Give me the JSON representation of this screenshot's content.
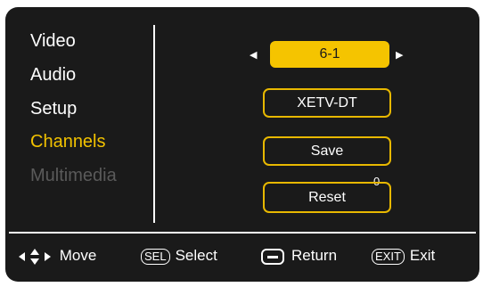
{
  "menu": {
    "items": [
      {
        "label": "Video",
        "state": "normal"
      },
      {
        "label": "Audio",
        "state": "normal"
      },
      {
        "label": "Setup",
        "state": "normal"
      },
      {
        "label": "Channels",
        "state": "active"
      },
      {
        "label": "Multimedia",
        "state": "disabled"
      }
    ]
  },
  "channels_panel": {
    "channel_number": "6-1",
    "station_name": "XETV-DT",
    "save_label": "Save",
    "reset_label": "Reset",
    "stray_digit": "0"
  },
  "footer": {
    "move_label": "Move",
    "select_key": "SEL",
    "select_label": "Select",
    "return_label": "Return",
    "exit_key": "EXIT",
    "exit_label": "Exit"
  },
  "colors": {
    "background": "#1a1a1a",
    "accent": "#f5c400",
    "text": "#ffffff",
    "disabled_text": "#5a5a5a"
  }
}
